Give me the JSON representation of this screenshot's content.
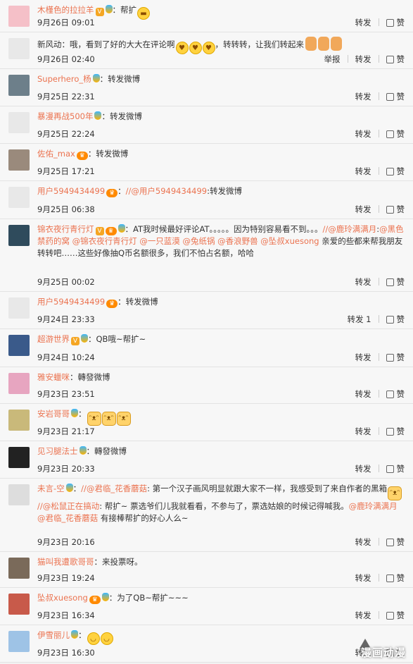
{
  "actions": {
    "forward": "转发",
    "like": "赞",
    "report": "举报"
  },
  "comments": [
    {
      "user": "木槿色的拉拉羊",
      "badges": [
        "v",
        "balloon"
      ],
      "text": "：帮扩",
      "emojis": 1,
      "emoji_kind": "grin",
      "time": "9月26日 09:01",
      "fwd_count": "",
      "avatar": "#f5c0c8"
    },
    {
      "user": "",
      "text": "新风动：哦，看到了好的大大在评论啊",
      "emojis": 3,
      "emoji_kind": "hearteyes",
      "text2": "，转转转，让我们转起来",
      "thumbs": 3,
      "time": "9月26日 02:40",
      "report": true,
      "avatar": "#e8e8e8"
    },
    {
      "user": "Superhero_杨",
      "badges": [
        "balloon"
      ],
      "text": "：转发微博",
      "time": "9月25日 22:31",
      "avatar": "#6d7f8a"
    },
    {
      "user": "暴漫再战500年",
      "badges": [
        "balloon"
      ],
      "text": "：转发微博",
      "time": "9月25日 22:24",
      "avatar": "#e8e8e8"
    },
    {
      "user": "佐佑_max",
      "badges": [
        "fans"
      ],
      "text": "：转发微博",
      "time": "9月25日 17:21",
      "avatar": "#9a8a7c"
    },
    {
      "user": "用户5949434499",
      "badges": [
        "fans"
      ],
      "text": "：//@用户5949434499:转发微博",
      "time": "9月25日 06:38",
      "avatar": "#e8e8e8"
    },
    {
      "user": "锦衣夜行青行灯",
      "badges": [
        "v",
        "fans",
        "balloon"
      ],
      "text": "：AT我时候最好评论AT。。。。。因为特别容易看不到。。。//@鹿玲满满月:@黑色禁药的窝 @锦衣夜行青行灯 @一只蓝漠 @兔纸锅 @香浪野兽 @坠叔xuesong 亲爱的些都来帮我朋友转转吧……这些好像抽Q币名额很多，我们不怕占名额，哈哈",
      "time": "9月25日 00:02",
      "avatar": "#2f4b5c"
    },
    {
      "user": "用户5949434499",
      "badges": [
        "fans"
      ],
      "text": "：转发微博",
      "time": "9月24日 23:33",
      "fwd_count": " 1",
      "avatar": "#e8e8e8"
    },
    {
      "user": "超游世界",
      "badges": [
        "v",
        "balloon"
      ],
      "text": "：QB哦~帮扩~",
      "time": "9月24日 10:24",
      "avatar": "#3a5a8a"
    },
    {
      "user": "雅安蠟咪",
      "badges": [],
      "text": "：轉發微博",
      "time": "9月23日 23:51",
      "avatar": "#e7a5c0"
    },
    {
      "user": "安岩哥哥",
      "badges": [
        "balloon"
      ],
      "text": "：",
      "cats": 3,
      "time": "9月23日 21:17",
      "avatar": "#c9b97a"
    },
    {
      "user": "见习腿法士",
      "badges": [
        "balloon"
      ],
      "text": "：轉發微博",
      "time": "9月23日 20:33",
      "avatar": "#222"
    },
    {
      "user": "未言-空",
      "badges": [
        "balloon"
      ],
      "text": "：//@君临_花香蘑菇: 第一个汉子画风明显就跟大家不一样，我感受到了来自作者的黑箱",
      "cats": 1,
      "text2": "//@松鼠正在搞动: 帮扩~ 票选爷们儿我就看看，不参与了，票选姑娘的时候记得喊我。@鹿玲满满月 @君临_花香蘑菇 有接棒帮扩的好心人么~",
      "time": "9月23日 20:16",
      "avatar": "#ddd"
    },
    {
      "user": "猫叫我遭歌哥哥",
      "badges": [],
      "text": "：来投票呀。",
      "time": "9月23日 19:24",
      "avatar": "#7a6a5a"
    },
    {
      "user": "坠叔xuesong",
      "badges": [
        "fans",
        "balloon"
      ],
      "text": "：为了QB~帮扩~~~",
      "time": "9月23日 16:34",
      "avatar": "#c85a4a"
    },
    {
      "user": "伊雪丽儿",
      "badges": [
        "balloon"
      ],
      "text": "：",
      "emojis": 2,
      "emoji_kind": "shy",
      "time": "9月23日 16:30",
      "avatar": "#9ec3e6"
    }
  ],
  "watermark": "漫画动漫"
}
